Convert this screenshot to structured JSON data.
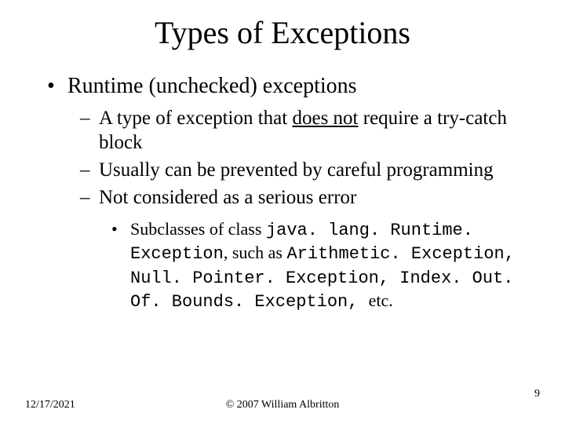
{
  "title": "Types of Exceptions",
  "bullet1": "Runtime (unchecked) exceptions",
  "sub1_pre": "A type of exception that ",
  "sub1_u": "does not",
  "sub1_post": " require a try-catch block",
  "sub2": "Usually can be prevented by careful programming",
  "sub3": "Not considered as a serious error",
  "sub4_pre": "Subclasses of class ",
  "sub4_c1": "java. lang. Runtime. Exception",
  "sub4_mid1": ", such as ",
  "sub4_c2": "Arithmetic. Exception, Null. Pointer. Exception, Index. Out. Of. Bounds. Exception, ",
  "sub4_post": " etc.",
  "date": "12/17/2021",
  "copyright": "© 2007 William Albritton",
  "page": "9"
}
